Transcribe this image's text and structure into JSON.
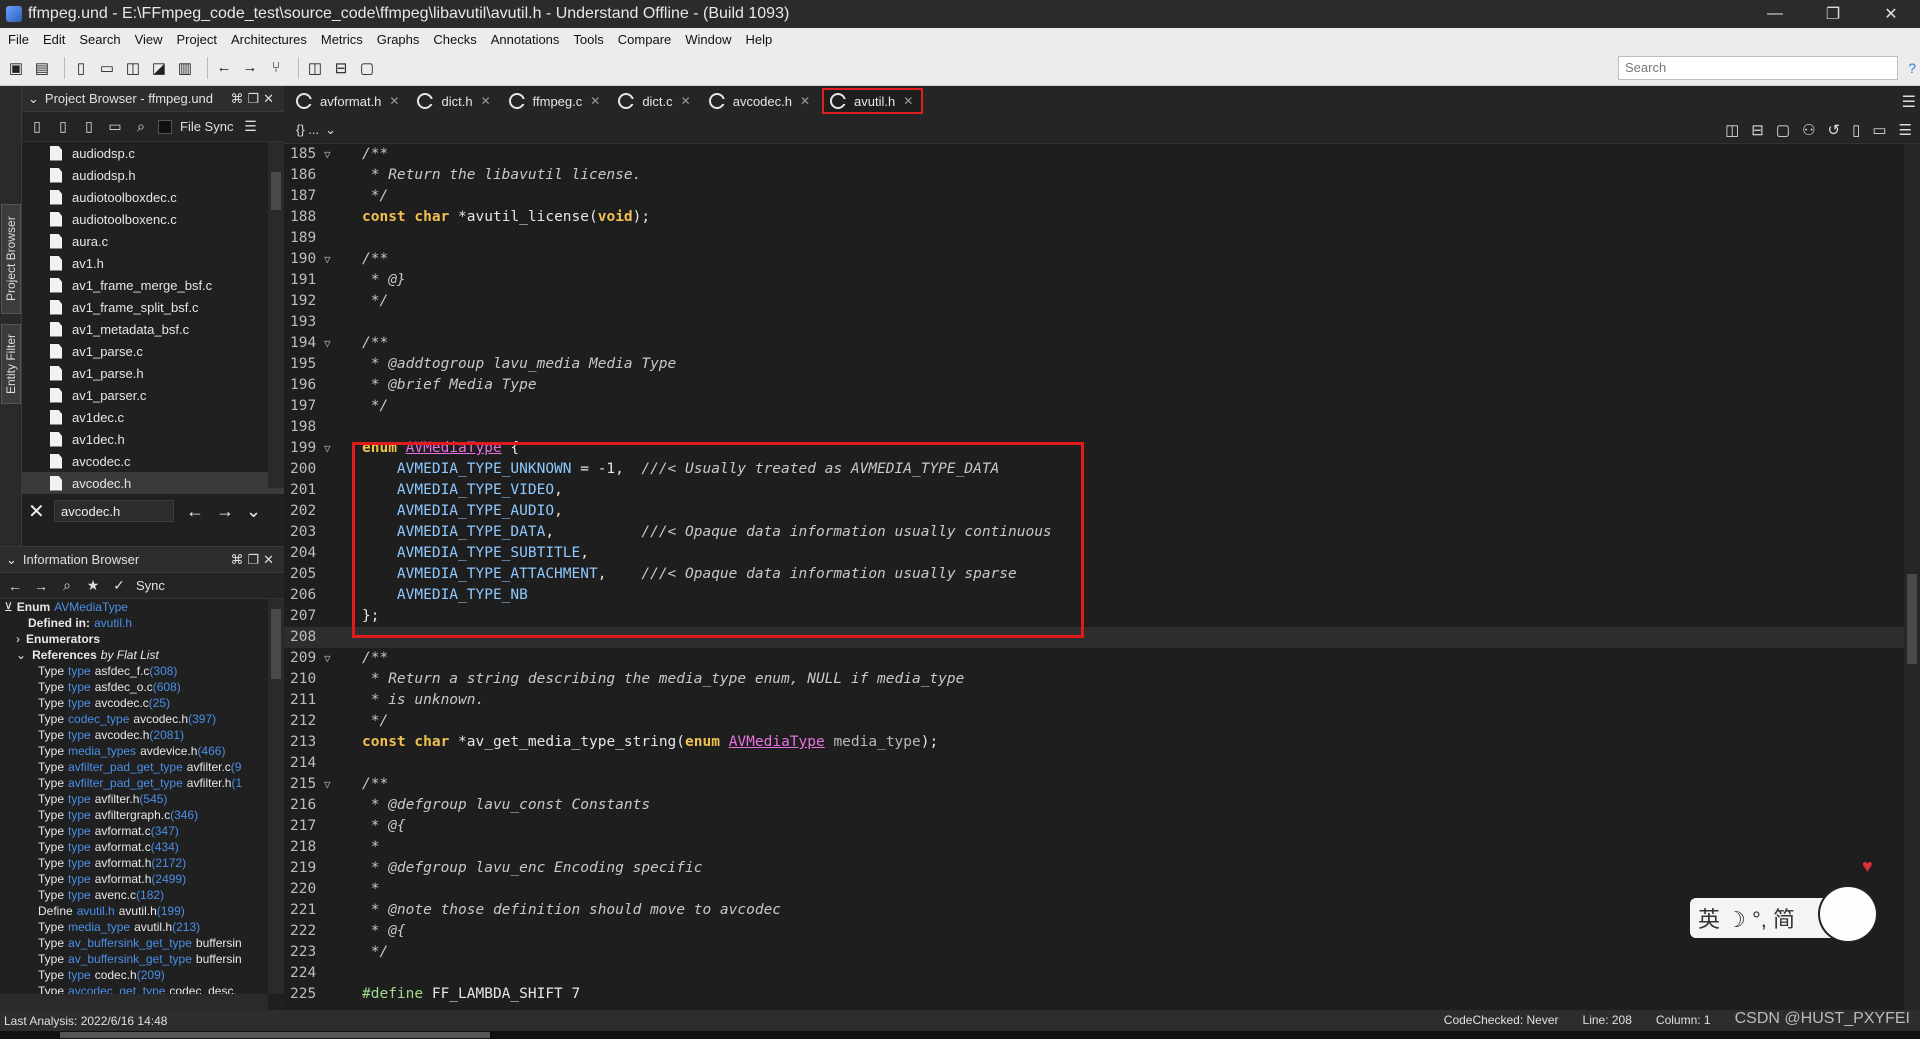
{
  "window": {
    "title": "ffmpeg.und - E:\\FFmpeg_code_test\\source_code\\ffmpeg\\libavutil\\avutil.h - Understand Offline - (Build 1093)",
    "minimize": "—",
    "restore": "❐",
    "close": "✕"
  },
  "menu": [
    "File",
    "Edit",
    "Search",
    "View",
    "Project",
    "Architectures",
    "Metrics",
    "Graphs",
    "Checks",
    "Annotations",
    "Tools",
    "Compare",
    "Window",
    "Help"
  ],
  "toolbar": {
    "search_placeholder": "Search",
    "help": "?"
  },
  "side_tabs": {
    "project_browser": "Project Browser",
    "entity_filter": "Entity Filter"
  },
  "project_browser": {
    "title": "Project Browser - ffmpeg.und",
    "file_sync_label": "File Sync",
    "files": [
      "audiodsp.c",
      "audiodsp.h",
      "audiotoolboxdec.c",
      "audiotoolboxenc.c",
      "aura.c",
      "av1.h",
      "av1_frame_merge_bsf.c",
      "av1_frame_split_bsf.c",
      "av1_metadata_bsf.c",
      "av1_parse.c",
      "av1_parse.h",
      "av1_parser.c",
      "av1dec.c",
      "av1dec.h",
      "avcodec.c",
      "avcodec.h"
    ],
    "selected_file": "avcodec.h",
    "nav_value": "avcodec.h"
  },
  "info_browser": {
    "title": "Information Browser",
    "sync_label": "Sync",
    "enum_label": "Enum",
    "enum_name": "AVMediaType",
    "defined_in_label": "Defined in:",
    "defined_in_file": "avutil.h",
    "enumerators_label": "Enumerators",
    "references_label": "References",
    "references_by": "by Flat List",
    "refs": [
      {
        "kind": "Type",
        "name": "type",
        "file": "asfdec_f.c",
        "line": "(308)"
      },
      {
        "kind": "Type",
        "name": "type",
        "file": "asfdec_o.c",
        "line": "(608)"
      },
      {
        "kind": "Type",
        "name": "type",
        "file": "avcodec.c",
        "line": "(25)"
      },
      {
        "kind": "Type",
        "name": "codec_type",
        "file": "avcodec.h",
        "line": "(397)"
      },
      {
        "kind": "Type",
        "name": "type",
        "file": "avcodec.h",
        "line": "(2081)"
      },
      {
        "kind": "Type",
        "name": "media_types",
        "file": "avdevice.h",
        "line": "(466)"
      },
      {
        "kind": "Type",
        "name": "avfilter_pad_get_type",
        "file": "avfilter.c",
        "line": "(9"
      },
      {
        "kind": "Type",
        "name": "avfilter_pad_get_type",
        "file": "avfilter.h",
        "line": "(1"
      },
      {
        "kind": "Type",
        "name": "type",
        "file": "avfilter.h",
        "line": "(545)"
      },
      {
        "kind": "Type",
        "name": "type",
        "file": "avfiltergraph.c",
        "line": "(346)"
      },
      {
        "kind": "Type",
        "name": "type",
        "file": "avformat.c",
        "line": "(347)"
      },
      {
        "kind": "Type",
        "name": "type",
        "file": "avformat.c",
        "line": "(434)"
      },
      {
        "kind": "Type",
        "name": "type",
        "file": "avformat.h",
        "line": "(2172)"
      },
      {
        "kind": "Type",
        "name": "type",
        "file": "avformat.h",
        "line": "(2499)"
      },
      {
        "kind": "Type",
        "name": "type",
        "file": "avenc.c",
        "line": "(182)"
      },
      {
        "kind": "Define",
        "name": "avutil.h",
        "file": "avutil.h",
        "line": "(199)"
      },
      {
        "kind": "Type",
        "name": "media_type",
        "file": "avutil.h",
        "line": "(213)"
      },
      {
        "kind": "Type",
        "name": "av_buffersink_get_type",
        "file": "buffersin",
        "line": ""
      },
      {
        "kind": "Type",
        "name": "av_buffersink_get_type",
        "file": "buffersin",
        "line": ""
      },
      {
        "kind": "Type",
        "name": "type",
        "file": "codec.h",
        "line": "(209)"
      },
      {
        "kind": "Type",
        "name": "avcodec_get_type",
        "file": "codec_desc.",
        "line": ""
      }
    ]
  },
  "tabs": [
    {
      "label": "avformat.h",
      "active": false
    },
    {
      "label": "dict.h",
      "active": false
    },
    {
      "label": "ffmpeg.c",
      "active": false
    },
    {
      "label": "dict.c",
      "active": false
    },
    {
      "label": "avcodec.h",
      "active": false
    },
    {
      "label": "avutil.h",
      "active": true
    }
  ],
  "editor": {
    "scope_label": "{} ...",
    "current_line": 208,
    "lines": [
      {
        "n": "185",
        "fold": true,
        "parts": [
          [
            "cm",
            "/**"
          ]
        ]
      },
      {
        "n": "186",
        "parts": [
          [
            "cm",
            " * Return the libavutil license."
          ]
        ]
      },
      {
        "n": "187",
        "parts": [
          [
            "cm",
            " */"
          ]
        ]
      },
      {
        "n": "188",
        "parts": [
          [
            "kwd",
            "const "
          ],
          [
            "kwd",
            "char "
          ],
          [
            "fn",
            "*avutil_license("
          ],
          [
            "kwd",
            "void"
          ],
          [
            "fn",
            ");"
          ]
        ]
      },
      {
        "n": "189",
        "parts": []
      },
      {
        "n": "190",
        "fold": true,
        "parts": [
          [
            "cm",
            "/**"
          ]
        ]
      },
      {
        "n": "191",
        "parts": [
          [
            "cm",
            " * @}"
          ]
        ]
      },
      {
        "n": "192",
        "parts": [
          [
            "cm",
            " */"
          ]
        ]
      },
      {
        "n": "193",
        "parts": []
      },
      {
        "n": "194",
        "fold": true,
        "parts": [
          [
            "cm",
            "/**"
          ]
        ]
      },
      {
        "n": "195",
        "parts": [
          [
            "cm",
            " * @addtogroup lavu_media Media Type"
          ]
        ]
      },
      {
        "n": "196",
        "parts": [
          [
            "cm",
            " * @brief Media Type"
          ]
        ]
      },
      {
        "n": "197",
        "parts": [
          [
            "cm",
            " */"
          ]
        ]
      },
      {
        "n": "198",
        "parts": []
      },
      {
        "n": "199",
        "fold": true,
        "parts": [
          [
            "kwd",
            "enum "
          ],
          [
            "enumname",
            "AVMediaType"
          ],
          [
            "fn",
            " {"
          ]
        ]
      },
      {
        "n": "200",
        "parts": [
          [
            "enumval",
            "    AVMEDIA_TYPE_UNKNOWN"
          ],
          [
            "fn",
            " = -1,  "
          ],
          [
            "cm",
            "///< Usually treated as AVMEDIA_TYPE_DATA"
          ]
        ]
      },
      {
        "n": "201",
        "parts": [
          [
            "enumval",
            "    AVMEDIA_TYPE_VIDEO"
          ],
          [
            "fn",
            ","
          ]
        ]
      },
      {
        "n": "202",
        "parts": [
          [
            "enumval",
            "    AVMEDIA_TYPE_AUDIO"
          ],
          [
            "fn",
            ","
          ]
        ]
      },
      {
        "n": "203",
        "parts": [
          [
            "enumval",
            "    AVMEDIA_TYPE_DATA"
          ],
          [
            "fn",
            ",          "
          ],
          [
            "cm",
            "///< Opaque data information usually continuous"
          ]
        ]
      },
      {
        "n": "204",
        "parts": [
          [
            "enumval",
            "    AVMEDIA_TYPE_SUBTITLE"
          ],
          [
            "fn",
            ","
          ]
        ]
      },
      {
        "n": "205",
        "parts": [
          [
            "enumval",
            "    AVMEDIA_TYPE_ATTACHMENT"
          ],
          [
            "fn",
            ",    "
          ],
          [
            "cm",
            "///< Opaque data information usually sparse"
          ]
        ]
      },
      {
        "n": "206",
        "parts": [
          [
            "enumval",
            "    AVMEDIA_TYPE_NB"
          ]
        ]
      },
      {
        "n": "207",
        "parts": [
          [
            "fn",
            "};"
          ]
        ]
      },
      {
        "n": "208",
        "parts": []
      },
      {
        "n": "209",
        "fold": true,
        "parts": [
          [
            "cm",
            "/**"
          ]
        ]
      },
      {
        "n": "210",
        "parts": [
          [
            "cm",
            " * Return a string describing the media_type enum, NULL if media_type"
          ]
        ]
      },
      {
        "n": "211",
        "parts": [
          [
            "cm",
            " * is unknown."
          ]
        ]
      },
      {
        "n": "212",
        "parts": [
          [
            "cm",
            " */"
          ]
        ]
      },
      {
        "n": "213",
        "parts": [
          [
            "kwd",
            "const "
          ],
          [
            "kwd",
            "char "
          ],
          [
            "fn",
            "*av_get_media_type_string("
          ],
          [
            "kwd",
            "enum "
          ],
          [
            "enumname",
            "AVMediaType"
          ],
          [
            "param",
            " media_type"
          ],
          [
            "fn",
            ");"
          ]
        ]
      },
      {
        "n": "214",
        "parts": []
      },
      {
        "n": "215",
        "fold": true,
        "parts": [
          [
            "cm",
            "/**"
          ]
        ]
      },
      {
        "n": "216",
        "parts": [
          [
            "cm",
            " * @defgroup lavu_const Constants"
          ]
        ]
      },
      {
        "n": "217",
        "parts": [
          [
            "cm",
            " * @{"
          ]
        ]
      },
      {
        "n": "218",
        "parts": [
          [
            "cm",
            " *"
          ]
        ]
      },
      {
        "n": "219",
        "parts": [
          [
            "cm",
            " * @defgroup lavu_enc Encoding specific"
          ]
        ]
      },
      {
        "n": "220",
        "parts": [
          [
            "cm",
            " *"
          ]
        ]
      },
      {
        "n": "221",
        "parts": [
          [
            "cm",
            " * @note those definition should move to avcodec"
          ]
        ]
      },
      {
        "n": "222",
        "parts": [
          [
            "cm",
            " * @{"
          ]
        ]
      },
      {
        "n": "223",
        "parts": [
          [
            "cm",
            " */"
          ]
        ]
      },
      {
        "n": "224",
        "parts": []
      },
      {
        "n": "225",
        "parts": [
          [
            "macro",
            "#define "
          ],
          [
            "fn",
            "FF_LAMBDA_SHIFT 7"
          ]
        ]
      }
    ]
  },
  "ime": {
    "text": "英 ☽ °, 简"
  },
  "status": {
    "last_analysis": "Last Analysis: 2022/6/16 14:48",
    "code_checked": "CodeChecked: Never",
    "line": "Line: 208",
    "column": "Column: 1",
    "watermark": "CSDN @HUST_PXYFEI"
  }
}
